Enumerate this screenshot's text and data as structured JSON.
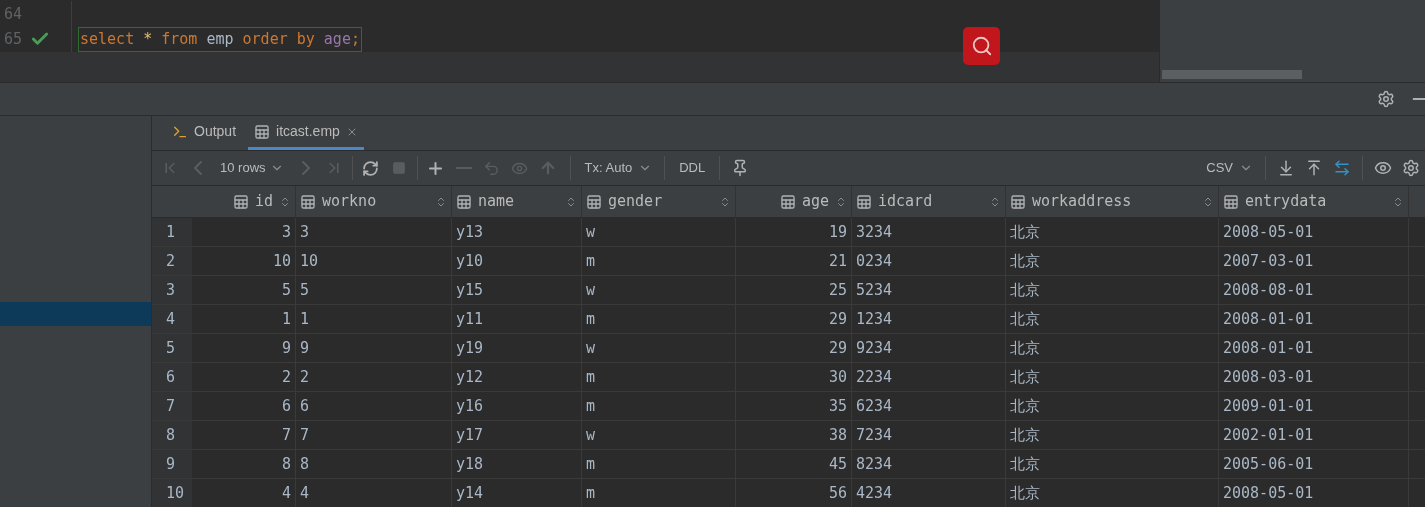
{
  "editor": {
    "lines": [
      {
        "number": "64",
        "ok": false
      },
      {
        "number": "65",
        "ok": true,
        "tokens": [
          {
            "text": "select",
            "kind": "keyword"
          },
          {
            "text": "*",
            "kind": "operator"
          },
          {
            "text": "from",
            "kind": "keyword"
          },
          {
            "text": "emp",
            "kind": "identifier"
          },
          {
            "text": "order",
            "kind": "keyword"
          },
          {
            "text": "by",
            "kind": "keyword"
          },
          {
            "text": "age",
            "kind": "column"
          },
          {
            "text": ";",
            "kind": "punct"
          }
        ]
      }
    ]
  },
  "tabs": [
    {
      "label": "Output",
      "selected": false,
      "closable": false
    },
    {
      "label": "itcast.emp",
      "selected": true,
      "closable": true
    }
  ],
  "toolbar": {
    "first_page": {
      "disabled": true
    },
    "prev_page": {
      "disabled": true
    },
    "rows_selector": "10 rows",
    "next_page": {
      "disabled": true
    },
    "last_page": {
      "disabled": true
    },
    "stop": {
      "disabled": true
    },
    "delete_row": {
      "disabled": true
    },
    "revert": {
      "disabled": true
    },
    "preview": {
      "disabled": true
    },
    "submit": {
      "disabled": true
    },
    "tx_mode": "Tx: Auto",
    "ddl": "DDL",
    "export_format": "CSV"
  },
  "table": {
    "columns": [
      "id",
      "workno",
      "name",
      "gender",
      "age",
      "idcard",
      "workaddress",
      "entrydata"
    ],
    "rows": [
      {
        "number": "1",
        "cells": [
          "3",
          "3",
          "y13",
          "w",
          "19",
          "3234",
          "北京",
          "2008-05-01"
        ]
      },
      {
        "number": "2",
        "cells": [
          "10",
          "10",
          "y10",
          "m",
          "21",
          "0234",
          "北京",
          "2007-03-01"
        ]
      },
      {
        "number": "3",
        "cells": [
          "5",
          "5",
          "y15",
          "w",
          "25",
          "5234",
          "北京",
          "2008-08-01"
        ]
      },
      {
        "number": "4",
        "cells": [
          "1",
          "1",
          "y11",
          "m",
          "29",
          "1234",
          "北京",
          "2008-01-01"
        ]
      },
      {
        "number": "5",
        "cells": [
          "9",
          "9",
          "y19",
          "w",
          "29",
          "9234",
          "北京",
          "2008-01-01"
        ]
      },
      {
        "number": "6",
        "cells": [
          "2",
          "2",
          "y12",
          "m",
          "30",
          "2234",
          "北京",
          "2008-03-01"
        ]
      },
      {
        "number": "7",
        "cells": [
          "6",
          "6",
          "y16",
          "m",
          "35",
          "6234",
          "北京",
          "2009-01-01"
        ]
      },
      {
        "number": "8",
        "cells": [
          "7",
          "7",
          "y17",
          "w",
          "38",
          "7234",
          "北京",
          "2002-01-01"
        ]
      },
      {
        "number": "9",
        "cells": [
          "8",
          "8",
          "y18",
          "m",
          "45",
          "8234",
          "北京",
          "2005-06-01"
        ]
      },
      {
        "number": "10",
        "cells": [
          "4",
          "4",
          "y14",
          "m",
          "56",
          "4234",
          "北京",
          "2008-05-01"
        ]
      }
    ]
  }
}
